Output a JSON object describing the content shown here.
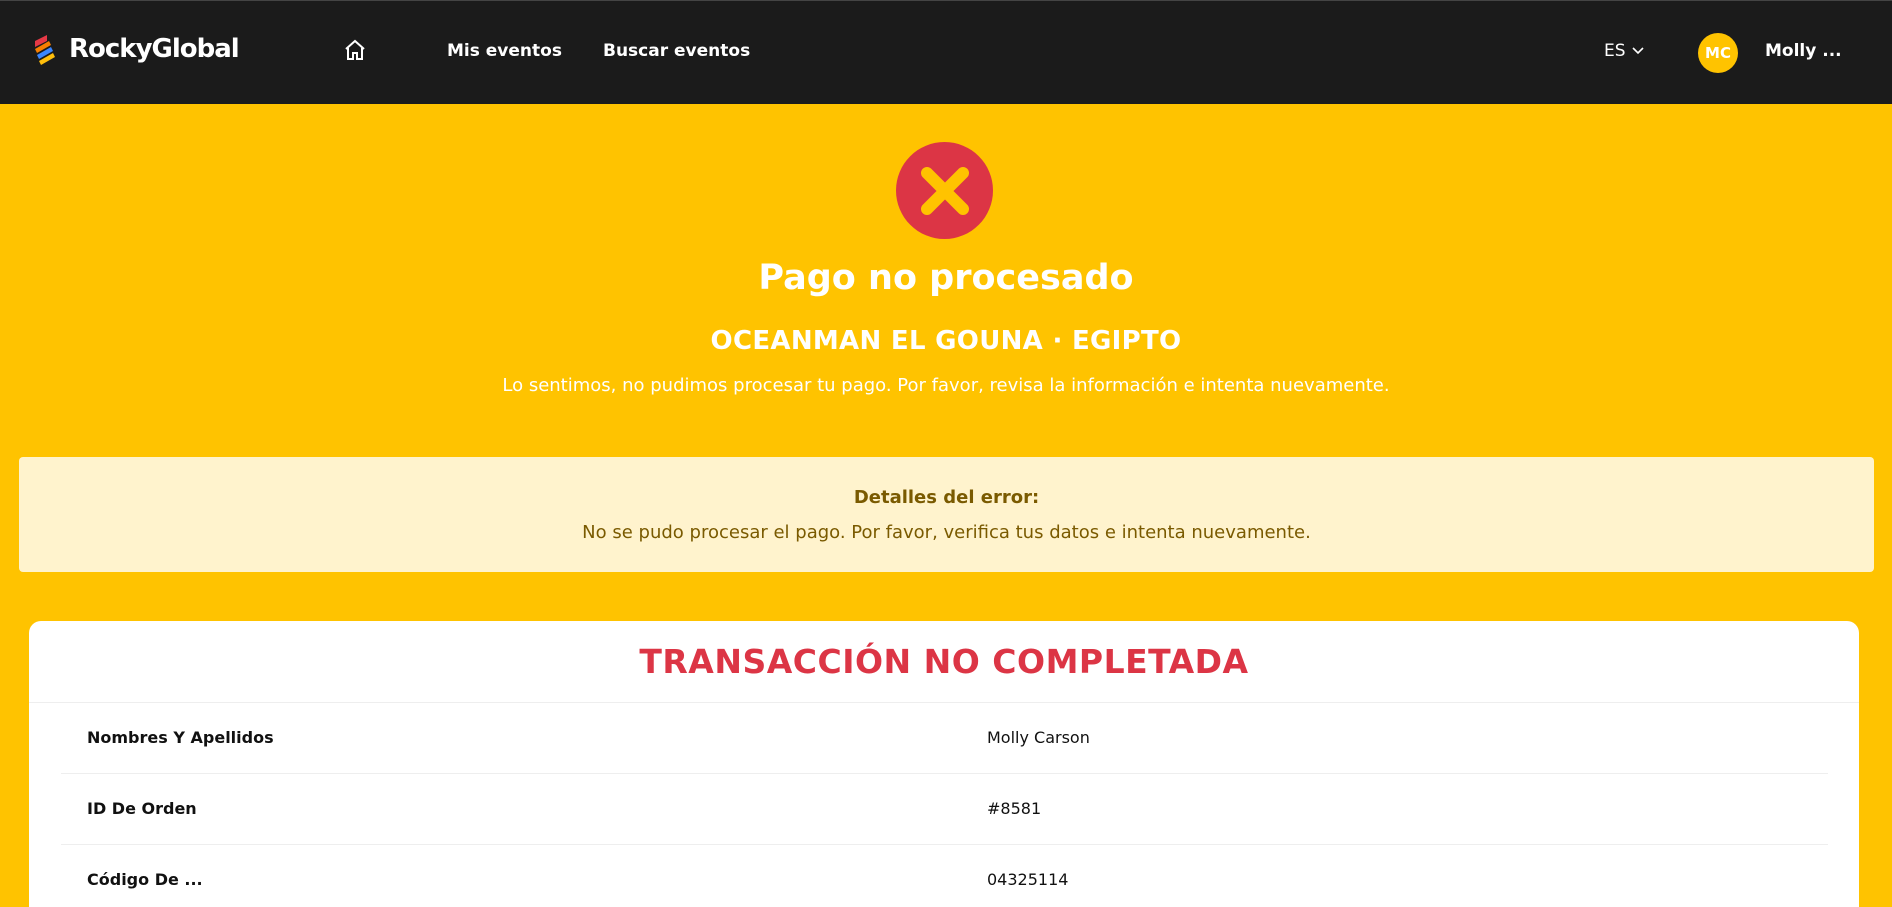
{
  "header": {
    "brand": "RockyGlobal",
    "nav": [
      {
        "label": "Mis eventos"
      },
      {
        "label": "Buscar eventos"
      }
    ],
    "language": "ES",
    "user_initials": "MC",
    "user_name": "Molly ..."
  },
  "status": {
    "icon": "error-x-icon",
    "title": "Pago no procesado",
    "event": "OCEANMAN EL GOUNA · EGIPTO",
    "message": "Lo sentimos, no pudimos procesar tu pago. Por favor, revisa la información e intenta nuevamente."
  },
  "error_details": {
    "label": "Detalles del error:",
    "text": "No se pudo procesar el pago. Por favor, verifica tus datos e intenta nuevamente."
  },
  "transaction": {
    "title": "TRANSACCIÓN NO COMPLETADA",
    "rows": [
      {
        "key": "Nombres Y Apellidos",
        "value": "Molly Carson"
      },
      {
        "key": "ID De Orden",
        "value": "#8581"
      },
      {
        "key": "Código De ...",
        "value": "04325114"
      }
    ]
  },
  "colors": {
    "accent": "#FFC300",
    "nav_bg": "#1b1b1b",
    "error": "#DC3545",
    "error_box_bg": "#FFF3CD"
  }
}
